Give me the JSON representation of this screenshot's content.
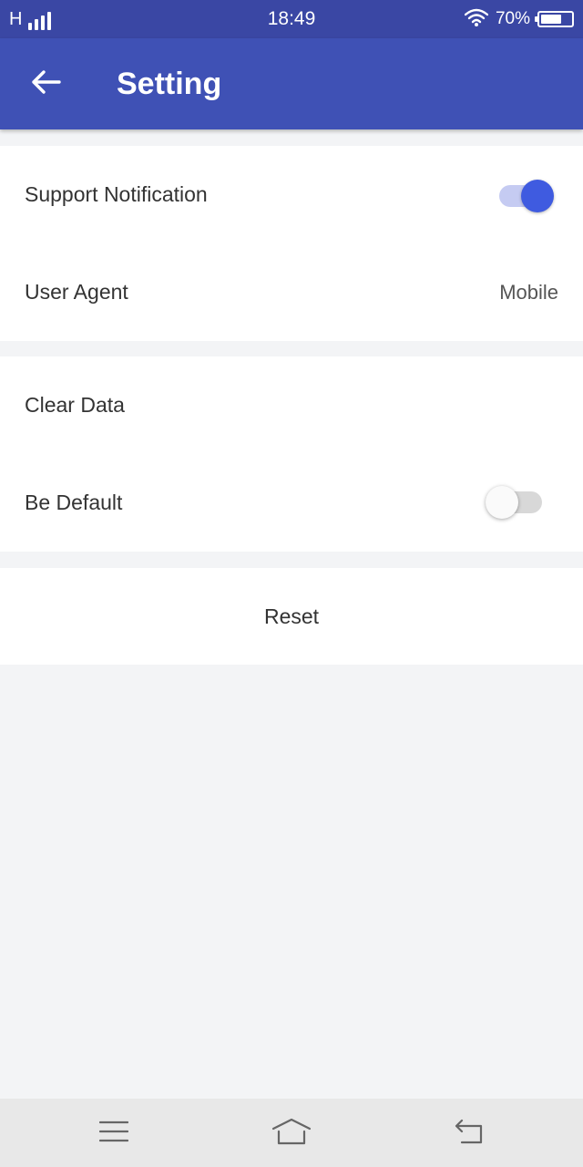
{
  "status_bar": {
    "network_type": "H",
    "signal_icon": "signal-bars-icon",
    "time": "18:49",
    "wifi_icon": "wifi-icon",
    "battery_percent": "70%",
    "battery_level": 0.7
  },
  "app_bar": {
    "back_icon": "arrow-back-icon",
    "title": "Setting",
    "color": "#3f51b5"
  },
  "sections": {
    "general": {
      "support_notification": {
        "label": "Support Notification",
        "enabled": true
      },
      "user_agent": {
        "label": "User Agent",
        "value": "Mobile"
      }
    },
    "data": {
      "clear_data": {
        "label": "Clear Data"
      },
      "be_default": {
        "label": "Be Default",
        "enabled": false
      }
    },
    "actions": {
      "reset": {
        "label": "Reset"
      }
    }
  },
  "colors": {
    "status_bar": "#3a47a4",
    "accent": "#3f5be0",
    "background": "#f3f4f6"
  },
  "nav_bar": {
    "menu_icon": "menu-icon",
    "home_icon": "home-icon",
    "back_icon": "back-icon"
  }
}
